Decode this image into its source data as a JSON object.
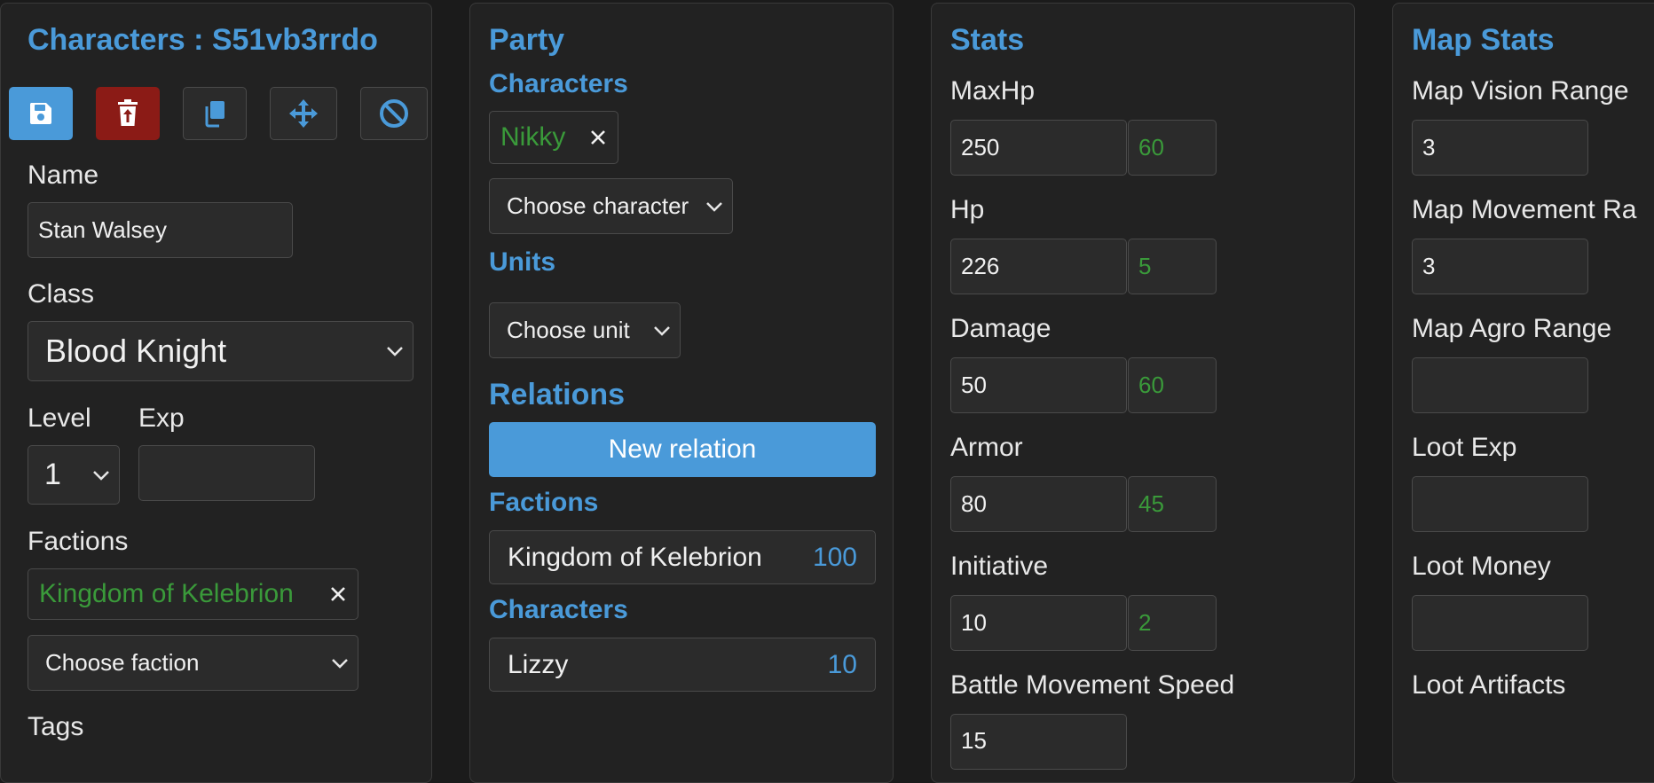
{
  "colors": {
    "accent": "#4a9ad9",
    "danger": "#8b1b16",
    "positive": "#3a9a3a",
    "background": "#1b1b1b",
    "panel": "#222222"
  },
  "character": {
    "title": "Characters : S51vb3rrdo",
    "toolbar": {
      "save_icon": "floppy-disk-icon",
      "delete_icon": "trash-upload-icon",
      "copy_icon": "copy-icon",
      "move_icon": "move-arrows-icon",
      "cancel_icon": "ban-icon"
    },
    "name_label": "Name",
    "name_value": "Stan Walsey",
    "class_label": "Class",
    "class_value": "Blood Knight",
    "level_label": "Level",
    "level_value": "1",
    "exp_label": "Exp",
    "exp_value": "",
    "factions_label": "Factions",
    "faction_tag": "Kingdom of Kelebrion",
    "faction_select": "Choose faction",
    "tags_label": "Tags"
  },
  "party": {
    "title": "Party",
    "characters_heading": "Characters",
    "character_tag": "Nikky",
    "character_select": "Choose character",
    "units_heading": "Units",
    "unit_select": "Choose unit",
    "relations_heading": "Relations",
    "new_relation_label": "New relation",
    "factions_heading": "Factions",
    "faction_relations": [
      {
        "name": "Kingdom of Kelebrion",
        "value": "100"
      }
    ],
    "characters_heading_2": "Characters",
    "character_relations": [
      {
        "name": "Lizzy",
        "value": "10"
      }
    ]
  },
  "stats": {
    "title": "Stats",
    "items": [
      {
        "label": "MaxHp",
        "value": "250",
        "bonus": "60"
      },
      {
        "label": "Hp",
        "value": "226",
        "bonus": "5"
      },
      {
        "label": "Damage",
        "value": "50",
        "bonus": "60"
      },
      {
        "label": "Armor",
        "value": "80",
        "bonus": "45"
      },
      {
        "label": "Initiative",
        "value": "10",
        "bonus": "2"
      },
      {
        "label": "Battle Movement Speed",
        "value": "15"
      }
    ]
  },
  "map_stats": {
    "title": "Map Stats",
    "items": [
      {
        "label": "Map Vision Range",
        "value": "3"
      },
      {
        "label": "Map Movement Ra",
        "value": "3"
      },
      {
        "label": "Map Agro Range",
        "value": ""
      },
      {
        "label": "Loot Exp",
        "value": ""
      },
      {
        "label": "Loot Money",
        "value": ""
      },
      {
        "label": "Loot Artifacts"
      }
    ]
  }
}
